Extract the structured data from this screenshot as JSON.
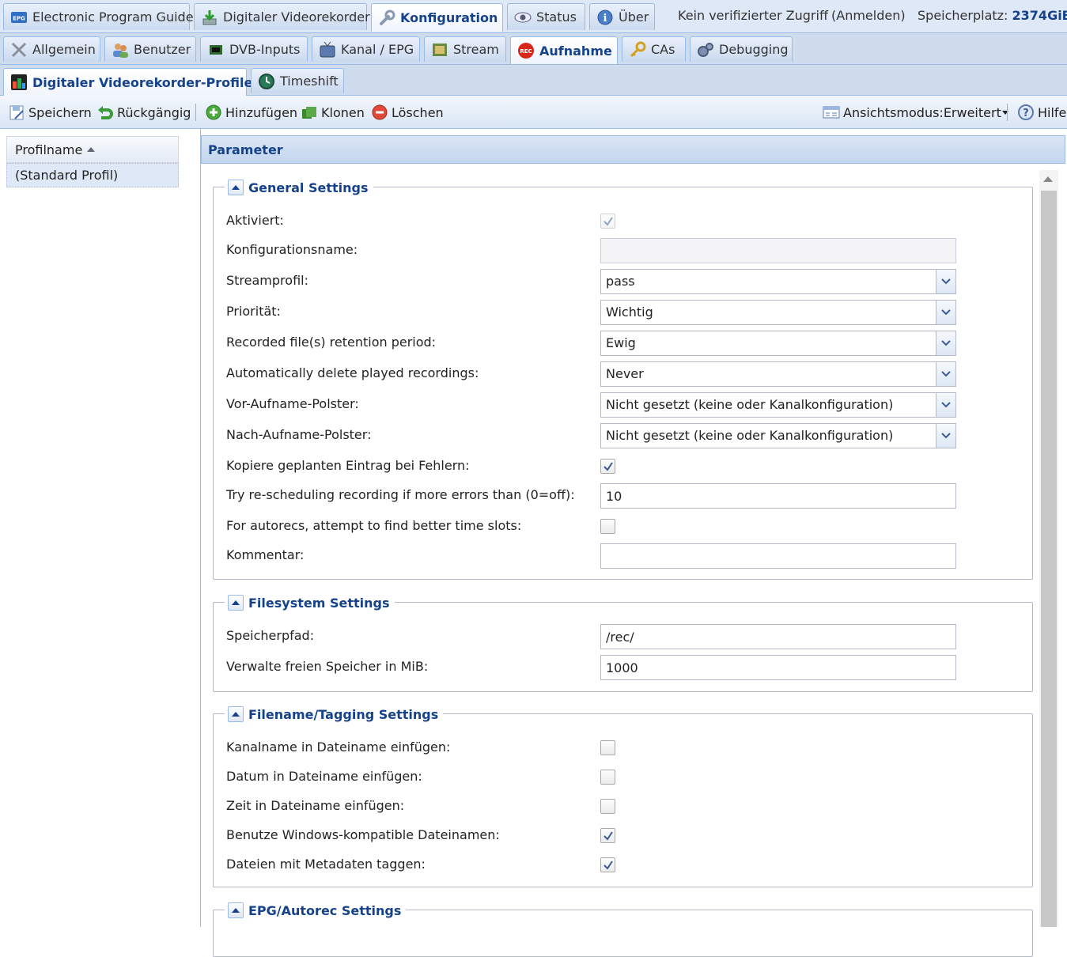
{
  "top_tabs": [
    {
      "label": "Electronic Program Guide",
      "icon": "epg-icon"
    },
    {
      "label": "Digitaler Videorekorder",
      "icon": "download-icon"
    },
    {
      "label": "Konfiguration",
      "icon": "wrench-icon",
      "active": true
    },
    {
      "label": "Status",
      "icon": "eye-icon"
    },
    {
      "label": "Über",
      "icon": "info-icon"
    }
  ],
  "header_info": {
    "access": "Kein verifizierter Zugriff",
    "login": "(Anmelden)",
    "storage_label": "Speicherplatz:",
    "storage_value": "2374GiB/"
  },
  "config_tabs": [
    {
      "label": "Allgemein",
      "icon": "tools-icon"
    },
    {
      "label": "Benutzer",
      "icon": "users-icon"
    },
    {
      "label": "DVB-Inputs",
      "icon": "chip-icon"
    },
    {
      "label": "Kanal / EPG",
      "icon": "tv-icon"
    },
    {
      "label": "Stream",
      "icon": "film-icon"
    },
    {
      "label": "Aufnahme",
      "icon": "rec-icon",
      "active": true
    },
    {
      "label": "CAs",
      "icon": "key-icon"
    },
    {
      "label": "Debugging",
      "icon": "gears-icon"
    }
  ],
  "sub_tabs": [
    {
      "label": "Digitaler Videorekorder-Profile",
      "icon": "dvr-icon",
      "active": true
    },
    {
      "label": "Timeshift",
      "icon": "timeshift-icon"
    }
  ],
  "toolbar": {
    "save": "Speichern",
    "undo": "Rückgängig",
    "add": "Hinzufügen",
    "clone": "Klonen",
    "delete": "Löschen",
    "view_mode_label": "Ansichtsmodus:",
    "view_mode_value": "Erweitert",
    "help": "Hilfe"
  },
  "profile_grid": {
    "column": "Profilname",
    "rows": [
      "(Standard Profil)"
    ]
  },
  "parameter_title": "Parameter",
  "general": {
    "title": "General Settings",
    "enabled_label": "Aktiviert:",
    "enabled": true,
    "config_name_label": "Konfigurationsname:",
    "config_name": "",
    "stream_profile_label": "Streamprofil:",
    "stream_profile": "pass",
    "priority_label": "Priorität:",
    "priority": "Wichtig",
    "retention_label": "Recorded file(s) retention period:",
    "retention": "Ewig",
    "autodelete_label": "Automatically delete played recordings:",
    "autodelete": "Never",
    "pre_padding_label": "Vor-Aufname-Polster:",
    "pre_padding": "Nicht gesetzt (keine oder Kanalkonfiguration)",
    "post_padding_label": "Nach-Aufname-Polster:",
    "post_padding": "Nicht gesetzt (keine oder Kanalkonfiguration)",
    "copy_on_error_label": "Kopiere geplanten Eintrag bei Fehlern:",
    "copy_on_error": true,
    "reschedule_label": "Try re-scheduling recording if more errors than (0=off):",
    "reschedule": "10",
    "better_slots_label": "For autorecs, attempt to find better time slots:",
    "better_slots": false,
    "comment_label": "Kommentar:",
    "comment": ""
  },
  "filesystem": {
    "title": "Filesystem Settings",
    "path_label": "Speicherpfad:",
    "path": "/rec/",
    "free_space_label": "Verwalte freien Speicher in MiB:",
    "free_space": "1000"
  },
  "filename": {
    "title": "Filename/Tagging Settings",
    "channel_label": "Kanalname in Dateiname einfügen:",
    "channel": false,
    "date_label": "Datum in Dateiname einfügen:",
    "date": false,
    "time_label": "Zeit in Dateiname einfügen:",
    "time": false,
    "windows_label": "Benutze Windows-kompatible Dateinamen:",
    "windows": true,
    "tag_label": "Dateien mit Metadaten taggen:",
    "tag": true
  },
  "epg": {
    "title": "EPG/Autorec Settings"
  }
}
